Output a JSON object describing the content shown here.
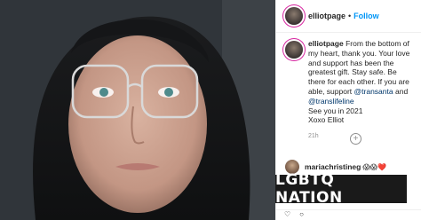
{
  "header": {
    "username": "elliotpage",
    "separator": "•",
    "follow_label": "Follow"
  },
  "caption": {
    "username": "elliotpage",
    "text_1": "From the bottom of my heart, thank you. Your love and support has been the greatest gift. Stay safe. Be there for each other. If you are able, support",
    "tag_1": "@transanta",
    "text_2": "and",
    "tag_2": "@translifeline",
    "line_3": "See you in 2021",
    "line_4": "Xoxo Elliot",
    "time": "21h"
  },
  "load_more": "+",
  "comment": {
    "username": "mariachristineg",
    "emoji": "😱😱❤️"
  },
  "logo_text": "LGBTQ NATION",
  "colors": {
    "follow": "#0095f6",
    "tag": "#00376b",
    "logo_bg": "#1a1a1a"
  }
}
